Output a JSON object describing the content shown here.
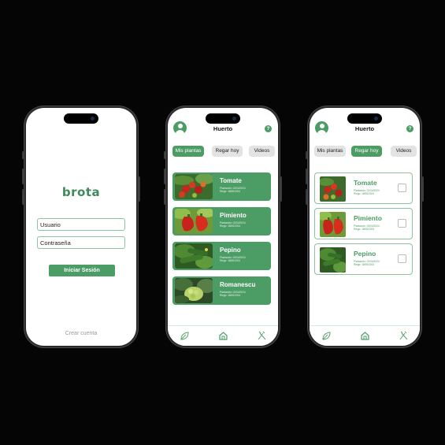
{
  "login": {
    "logo": "brota",
    "username_value": "Usuario",
    "password_value": "Contraseña",
    "login_button": "Iniciar Sesión",
    "create_account": "Crear cuenta"
  },
  "app": {
    "title": "Huerto",
    "help": "?",
    "tabs": [
      "Mis plantas",
      "Regar hoy",
      "Videos"
    ],
    "nav_icons": [
      "leaf-icon",
      "home-icon",
      "tools-icon"
    ]
  },
  "screen2": {
    "active_tab": "Mis plantas",
    "plants": [
      {
        "name": "Tomate",
        "planted": "Plantación: 02/04/2024",
        "water": "Riego: 18/06/2024"
      },
      {
        "name": "Pimiento",
        "planted": "Plantación: 02/04/2024",
        "water": "Riego: 18/06/2024"
      },
      {
        "name": "Pepino",
        "planted": "Plantación: 02/04/2024",
        "water": "Riego: 18/06/2024"
      },
      {
        "name": "Romanescu",
        "planted": "Plantación: 02/04/2024",
        "water": "Riego: 18/06/2024"
      }
    ]
  },
  "screen3": {
    "active_tab": "Regar hoy",
    "plants": [
      {
        "name": "Tomate",
        "planted": "Plantación: 02/04/2024",
        "water": "Riego: 18/06/2024",
        "checked": false
      },
      {
        "name": "Pimiento",
        "planted": "Plantación: 02/04/2024",
        "water": "Riego: 18/06/2024",
        "checked": false
      },
      {
        "name": "Pepino",
        "planted": "Plantación: 02/04/2024",
        "water": "Riego: 18/06/2024",
        "checked": false
      }
    ]
  },
  "colors": {
    "brand_green": "#4b9c65",
    "light_green_border": "#8fc29e",
    "background": "#050505"
  }
}
